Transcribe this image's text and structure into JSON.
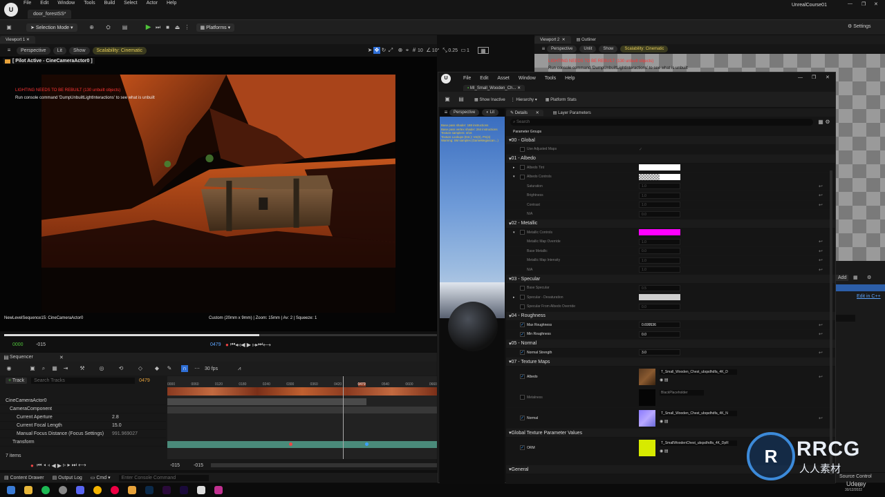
{
  "app": {
    "project": "UnrealCourse01",
    "level_tab": "door_forestSS*"
  },
  "menu": [
    "File",
    "Edit",
    "Window",
    "Tools",
    "Build",
    "Select",
    "Actor",
    "Help"
  ],
  "toolbar": {
    "selection_mode": "Selection Mode",
    "platforms": "Platforms",
    "settings": "Settings"
  },
  "viewport1": {
    "tab": "Viewport 1",
    "perspective": "Perspective",
    "lit": "Lit",
    "show": "Show",
    "scalability": "Scalability: Cinematic",
    "snap_grid": "10",
    "snap_rot": "10°",
    "snap_scale": "0.25",
    "cam_speed": "1",
    "pilot": "[ Pilot Active - CineCameraActor0 ]",
    "warning": "LIGHTING NEEDS TO BE REBUILT (130 unbuilt objects)",
    "console_hint": "Run console command 'DumpUnbuiltLightInteractions' to see what is unbuilt",
    "seq_label": "NewLevelSequence15: CineCameraActor0",
    "cam_info": "Custom (20mm x 9mm) | Zoom: 15mm | Av: 2 | Squeeze: 1",
    "time_start": "0000",
    "time_neg": "-015",
    "time_cur": "0479"
  },
  "sequencer": {
    "tab": "Sequencer",
    "fps": "30 fps",
    "add_track": "Track",
    "search": "Search Tracks",
    "frame": "0479",
    "ruler": [
      "0000",
      "0060",
      "0120",
      "0180",
      "0240",
      "0300",
      "0360",
      "0420",
      "0479",
      "0540",
      "0600",
      "0660"
    ],
    "tracks": [
      {
        "name": "CineCameraActor0",
        "value": ""
      },
      {
        "name": "CameraComponent",
        "value": ""
      },
      {
        "name": "Current Aperture",
        "value": "2.8"
      },
      {
        "name": "Current Focal Length",
        "value": "15.0"
      },
      {
        "name": "Manual Focus Distance (Focus Settings)",
        "value": "991.969027"
      },
      {
        "name": "Transform",
        "value": ""
      }
    ],
    "items": "7 items",
    "bottom_start": "-015",
    "bottom_end": "-015"
  },
  "status": {
    "content_drawer": "Content Drawer",
    "output_log": "Output Log",
    "cmd": "Cmd",
    "console_placeholder": "Enter Console Command",
    "source_control": "Source Control"
  },
  "viewport2": {
    "tab": "Viewport 2",
    "outliner": "Outliner",
    "perspective": "Perspective",
    "unlit": "Unlit",
    "show": "Show",
    "scalability": "Scalability: Cinematic",
    "warning": "LIGHTING NEEDS TO BE REBUILT (130 unbuilt objects)",
    "hint": "Run console command 'DumpUnbuiltLightInteractions' to see what is unbuilt"
  },
  "material": {
    "menu": [
      "File",
      "Edit",
      "Asset",
      "Window",
      "Tools",
      "Help"
    ],
    "tab": "MI_Small_Wooden_Ch...",
    "show_inactive": "Show Inactive",
    "hierarchy": "Hierarchy",
    "platform_stats": "Platform Stats",
    "perspective": "Perspective",
    "lit": "Lit",
    "stats": [
      "Base pass shader: 188 instructions",
      "Base pass vertex shader: 264 instructions",
      "Texture samplers: 4/16",
      "Texture Lookups (Est.): VS(0), PS(4)",
      "Warning: SM samples (GameMegascan...)"
    ],
    "details": "Details",
    "layer_params": "Layer Parameters",
    "search": "Search",
    "param_groups": "Parameter Groups",
    "sections": {
      "global": "00 - Global",
      "albedo": "01 - Albedo",
      "metallic": "02 - Metallic",
      "specular": "03 - Specular",
      "roughness": "04 - Roughness",
      "normal": "05 - Normal",
      "texmaps": "07 - Texture Maps",
      "gtex": "Global Texture Parameter Values",
      "general": "General"
    },
    "p": {
      "use_adjusted": "Use Adjusted Maps",
      "albedo_tint": "Albedo Tint",
      "albedo_controls": "Albedo Controls",
      "saturation": "Saturation",
      "saturation_v": "1.0",
      "brightness": "Brightness",
      "brightness_v": "1.0",
      "contrast": "Contrast",
      "contrast_v": "1.0",
      "na1": "N/A",
      "na1_v": "0.0",
      "metallic_controls": "Metallic Controls",
      "metal_override": "Metallic Map Override",
      "metal_override_v": "1.0",
      "base_metallic": "Base Metallic",
      "base_metallic_v": "0.0",
      "metal_intensity": "Metallic Map Intensity",
      "metal_intensity_v": "1.0",
      "na2": "N/A",
      "na2_v": "1.0",
      "base_spec": "Base Specular",
      "base_spec_v": "0.5",
      "spec_desat": "Specular - Desaturation",
      "spec_from_albedo": "Specular From Albedo Override",
      "spec_from_albedo_v": "0.0",
      "max_rough": "Max Roughness",
      "max_rough_v": "0.699536",
      "min_rough": "Min Roughness",
      "min_rough_v": "0.0",
      "normal_strength": "Normal Strength",
      "normal_strength_v": "3.0",
      "albedo_map": "Albedo",
      "albedo_tex": "T_Small_Wooden_Chest_ubqsdhdfa_4K_D",
      "metalness": "Metalness",
      "metal_tex": "BlackPlaceholder",
      "normal_map": "Normal",
      "normal_tex": "T_Small_Wooden_Chest_ubqsdhdfa_4K_N",
      "orm": "ORM",
      "orm_tex": "T_SmallWoodenChest_ubqsdhdfa_4K_DpR"
    },
    "colors": {
      "albedo_tint": "#ffffff",
      "metallic": "#ff00ff",
      "spec_desat": "#cfcfcf",
      "orm": "#d7ea00"
    }
  },
  "right_panel": {
    "add": "Add",
    "edit_cpp": "Edit in C++"
  },
  "watermark": {
    "logo": "RRCG",
    "sub": "人人素材",
    "udemy": "Udemy"
  },
  "taskbar": {
    "time": "7:17",
    "date": "30/12/2022"
  }
}
